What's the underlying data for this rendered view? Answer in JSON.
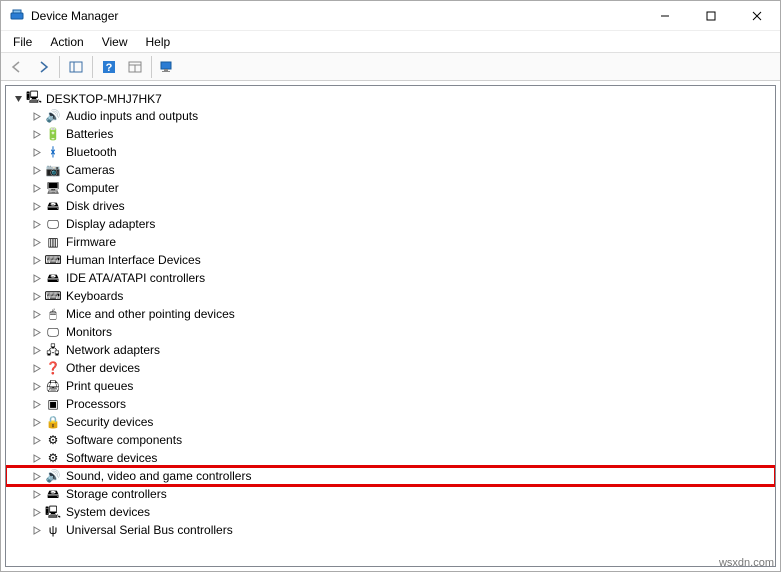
{
  "window": {
    "title": "Device Manager"
  },
  "menubar": [
    "File",
    "Action",
    "View",
    "Help"
  ],
  "toolbar": {
    "back": "back-icon",
    "forward": "forward-icon",
    "panels": "panels-icon",
    "help": "help-icon",
    "refresh": "refresh-icon",
    "devices": "devices-icon"
  },
  "tree": {
    "root": "DESKTOP-MHJ7HK7",
    "nodes": [
      {
        "label": "Audio inputs and outputs",
        "icon": "audio-icon"
      },
      {
        "label": "Batteries",
        "icon": "battery-icon"
      },
      {
        "label": "Bluetooth",
        "icon": "bluetooth-icon"
      },
      {
        "label": "Cameras",
        "icon": "camera-icon"
      },
      {
        "label": "Computer",
        "icon": "computer-icon"
      },
      {
        "label": "Disk drives",
        "icon": "disk-icon"
      },
      {
        "label": "Display adapters",
        "icon": "display-icon"
      },
      {
        "label": "Firmware",
        "icon": "firmware-icon"
      },
      {
        "label": "Human Interface Devices",
        "icon": "hid-icon"
      },
      {
        "label": "IDE ATA/ATAPI controllers",
        "icon": "ide-icon"
      },
      {
        "label": "Keyboards",
        "icon": "keyboard-icon"
      },
      {
        "label": "Mice and other pointing devices",
        "icon": "mouse-icon"
      },
      {
        "label": "Monitors",
        "icon": "monitor-icon"
      },
      {
        "label": "Network adapters",
        "icon": "network-icon"
      },
      {
        "label": "Other devices",
        "icon": "other-icon"
      },
      {
        "label": "Print queues",
        "icon": "printer-icon"
      },
      {
        "label": "Processors",
        "icon": "processor-icon"
      },
      {
        "label": "Security devices",
        "icon": "security-icon"
      },
      {
        "label": "Software components",
        "icon": "swcomp-icon"
      },
      {
        "label": "Software devices",
        "icon": "swdev-icon"
      },
      {
        "label": "Sound, video and game controllers",
        "icon": "sound-icon",
        "highlight": true
      },
      {
        "label": "Storage controllers",
        "icon": "storage-icon"
      },
      {
        "label": "System devices",
        "icon": "system-icon"
      },
      {
        "label": "Universal Serial Bus controllers",
        "icon": "usb-icon"
      }
    ]
  },
  "watermark": "wsxdn.com",
  "icons": {
    "audio-icon": "🔊",
    "battery-icon": "🔋",
    "bluetooth-icon": "ᚼ",
    "camera-icon": "📷",
    "computer-icon": "🖥",
    "disk-icon": "🖴",
    "display-icon": "🖵",
    "firmware-icon": "▥",
    "hid-icon": "⌨",
    "ide-icon": "🖴",
    "keyboard-icon": "⌨",
    "mouse-icon": "🖱",
    "monitor-icon": "🖵",
    "network-icon": "🖧",
    "other-icon": "❓",
    "printer-icon": "🖨",
    "processor-icon": "▣",
    "security-icon": "🔒",
    "swcomp-icon": "⚙",
    "swdev-icon": "⚙",
    "sound-icon": "🔊",
    "storage-icon": "🖴",
    "system-icon": "🖳",
    "usb-icon": "ψ",
    "root-icon": "🖳"
  }
}
